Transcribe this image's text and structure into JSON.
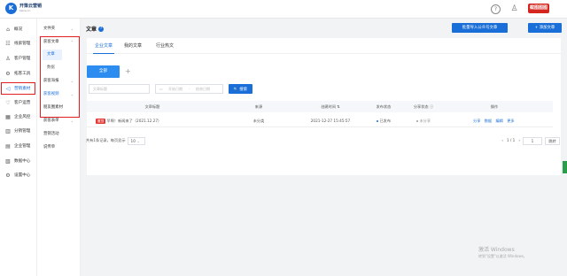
{
  "app": {
    "logo_title": "开策云营销",
    "logo_sub": "kaice.cn",
    "logo_mark": "K",
    "help_icon": "?",
    "user_icon": "♙",
    "badge": "截图图图"
  },
  "sidebar": {
    "items": [
      {
        "icon": "⌂",
        "label": "概况"
      },
      {
        "icon": "☷",
        "label": "线索管理"
      },
      {
        "icon": "♙",
        "label": "客户管理"
      },
      {
        "icon": "⚙",
        "label": "拓客工具"
      },
      {
        "icon": "◁",
        "label": "营销素材"
      },
      {
        "icon": "♡",
        "label": "客户运营"
      },
      {
        "icon": "▦",
        "label": "企业风控"
      },
      {
        "icon": "▥",
        "label": "分销管理"
      },
      {
        "icon": "▤",
        "label": "企业管理"
      },
      {
        "icon": "▧",
        "label": "数据中心"
      },
      {
        "icon": "⚙",
        "label": "设置中心"
      }
    ]
  },
  "subnav": {
    "items": [
      {
        "label": "文件夹",
        "arrow": "⌄"
      },
      {
        "label": "获客文章",
        "arrow": "⌃"
      },
      {
        "label": "文章"
      },
      {
        "label": "数据"
      },
      {
        "label": "获客海报",
        "arrow": "⌄"
      },
      {
        "label": "获客视频",
        "arrow": "⌄"
      },
      {
        "label": "朋友圈素材"
      },
      {
        "label": "获客表单",
        "arrow": "⌄"
      },
      {
        "label": "营销活动"
      },
      {
        "label": "说传单"
      }
    ]
  },
  "main": {
    "title": "文章",
    "help": "?",
    "batch_import": "批量导入公众号文章",
    "add_article": "+ 添加文章",
    "tabs": [
      "企业文章",
      "我的文章",
      "行业热文"
    ],
    "folder_all": "全部",
    "folder_add": "+",
    "filters": {
      "title_placeholder": "文章标题",
      "date_start": "开始日期",
      "date_sep": "-",
      "date_end": "结束日期",
      "date_icon": "▭",
      "search": "搜索",
      "search_icon": "🔍"
    },
    "table": {
      "columns": [
        "文章标题",
        "来源",
        "创建时间 ⇅",
        "发布状态",
        "分享状态 ⓘ",
        "操作"
      ],
      "rows": [
        {
          "tag": "置顶",
          "title": "早啊！新闻来了（2021.12.27）",
          "source": "未分类",
          "created": "2021-12-27 15:45:57",
          "publish": "已发布",
          "share": "未分享",
          "ops": [
            "分享",
            "数据",
            "编辑",
            "更多"
          ]
        }
      ]
    },
    "pager": {
      "summary": "共有1条记录，每页显示",
      "page_size": "10",
      "prev": "‹",
      "page_info": "1 / 1",
      "next": "›",
      "goto_value": "1",
      "jump": "跳转"
    }
  },
  "watermark": {
    "line1": "激活 Windows",
    "line2": "转到\"设置\"以激活 Windows。"
  },
  "colors": {
    "accent": "#1a6ed8",
    "highlight": "#e02020"
  }
}
